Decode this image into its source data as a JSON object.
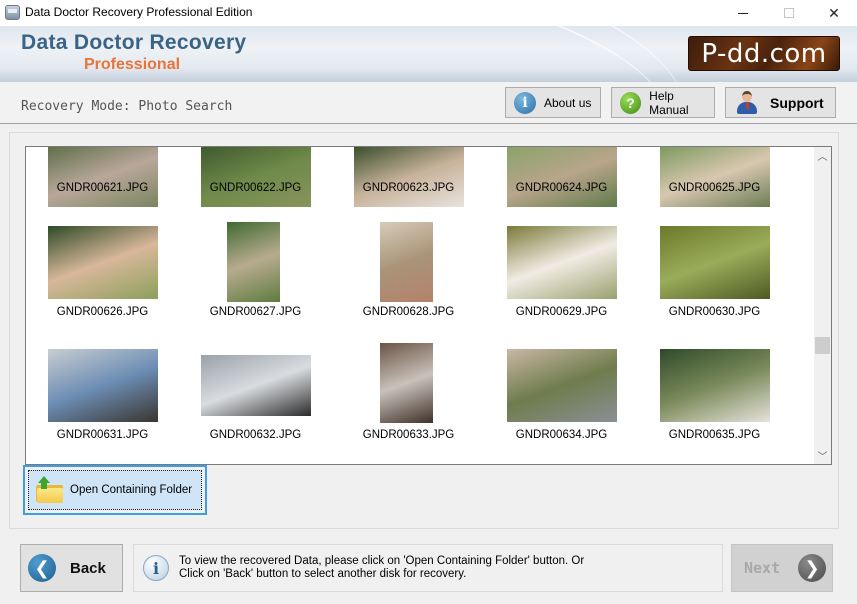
{
  "window": {
    "title": "Data Doctor Recovery Professional Edition",
    "controls": {
      "minimize": "minimize",
      "maximize": "maximize",
      "close": "close"
    }
  },
  "banner": {
    "brand_main": "Data Doctor Recovery",
    "brand_sub": "Professional",
    "logo_text": "P-dd.com",
    "brand_color": "#3a6487",
    "sub_color": "#e8743a"
  },
  "toolbar": {
    "mode_label": "Recovery Mode: Photo Search",
    "about_label": "About us",
    "help_label": "Help Manual",
    "support_label": "Support"
  },
  "gallery": {
    "items": [
      {
        "name": "GNDR00621.JPG",
        "colors": [
          "#5f6f4a",
          "#b9a79a",
          "#7a8560"
        ]
      },
      {
        "name": "GNDR00622.JPG",
        "colors": [
          "#3f5a2e",
          "#6f8a4a",
          "#88945c"
        ]
      },
      {
        "name": "GNDR00623.JPG",
        "colors": [
          "#3b4f2c",
          "#c7b29a",
          "#e9e2dc"
        ]
      },
      {
        "name": "GNDR00624.JPG",
        "colors": [
          "#8aa36a",
          "#b8a58a",
          "#5f7a4a"
        ]
      },
      {
        "name": "GNDR00625.JPG",
        "colors": [
          "#7d9a5e",
          "#d8c7b0",
          "#6b7c54"
        ]
      },
      {
        "name": "GNDR00626.JPG",
        "colors": [
          "#2e4a26",
          "#d8b79a",
          "#8ca05c"
        ]
      },
      {
        "name": "GNDR00627.JPG",
        "colors": [
          "#3f6a30",
          "#b8ab8f",
          "#5e7c3e"
        ]
      },
      {
        "name": "GNDR00628.JPG",
        "colors": [
          "#d7cbb8",
          "#a99479",
          "#b4826a"
        ]
      },
      {
        "name": "GNDR00629.JPG",
        "colors": [
          "#7a7a3a",
          "#f1ece4",
          "#9aa070"
        ]
      },
      {
        "name": "GNDR00630.JPG",
        "colors": [
          "#6b7a2a",
          "#9aab5a",
          "#4d5a22"
        ]
      },
      {
        "name": "GNDR00631.JPG",
        "colors": [
          "#c9cdd2",
          "#6c8db4",
          "#3a3530"
        ]
      },
      {
        "name": "GNDR00632.JPG",
        "colors": [
          "#9aa1a9",
          "#d9dcdf",
          "#2b2b2b"
        ]
      },
      {
        "name": "GNDR00633.JPG",
        "colors": [
          "#6b5446",
          "#c8c2ba",
          "#3f3029"
        ]
      },
      {
        "name": "GNDR00634.JPG",
        "colors": [
          "#c9b7a6",
          "#6f7c4c",
          "#8a8f96"
        ]
      },
      {
        "name": "GNDR00635.JPG",
        "colors": [
          "#2f4a2a",
          "#7a8a5a",
          "#e6e2dc"
        ]
      }
    ],
    "scroll_position": 0.65
  },
  "actions": {
    "open_folder_label": "Open Containing Folder"
  },
  "footer": {
    "back_label": "Back",
    "next_label": "Next",
    "message_line1": "To view the recovered Data, please click on 'Open Containing Folder' button. Or",
    "message_line2": "Click on 'Back' button to select another disk for recovery."
  }
}
